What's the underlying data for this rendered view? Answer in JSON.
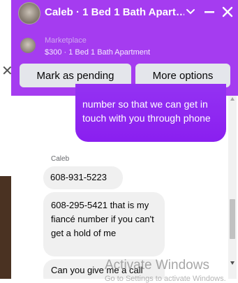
{
  "header": {
    "title": "Caleb · 1 Bed 1 Bath Apart…",
    "color": "#a53cf0"
  },
  "listing": {
    "label": "Marketplace",
    "subtitle": "$300 · 1 Bed 1 Bath Apartment"
  },
  "actions": {
    "pending_label": "Mark as pending",
    "more_label": "More options"
  },
  "messages": {
    "outgoing": "number so that we can get in touch with you through phone",
    "sender": "Caleb",
    "incoming": [
      "608-931-5223",
      "608-295-5421 that is my fiancé number if you can't get a hold of me",
      "Can you give me a call"
    ]
  },
  "watermark": {
    "title": "Activate Windows",
    "subtitle": "Go to Settings to activate Windows."
  }
}
